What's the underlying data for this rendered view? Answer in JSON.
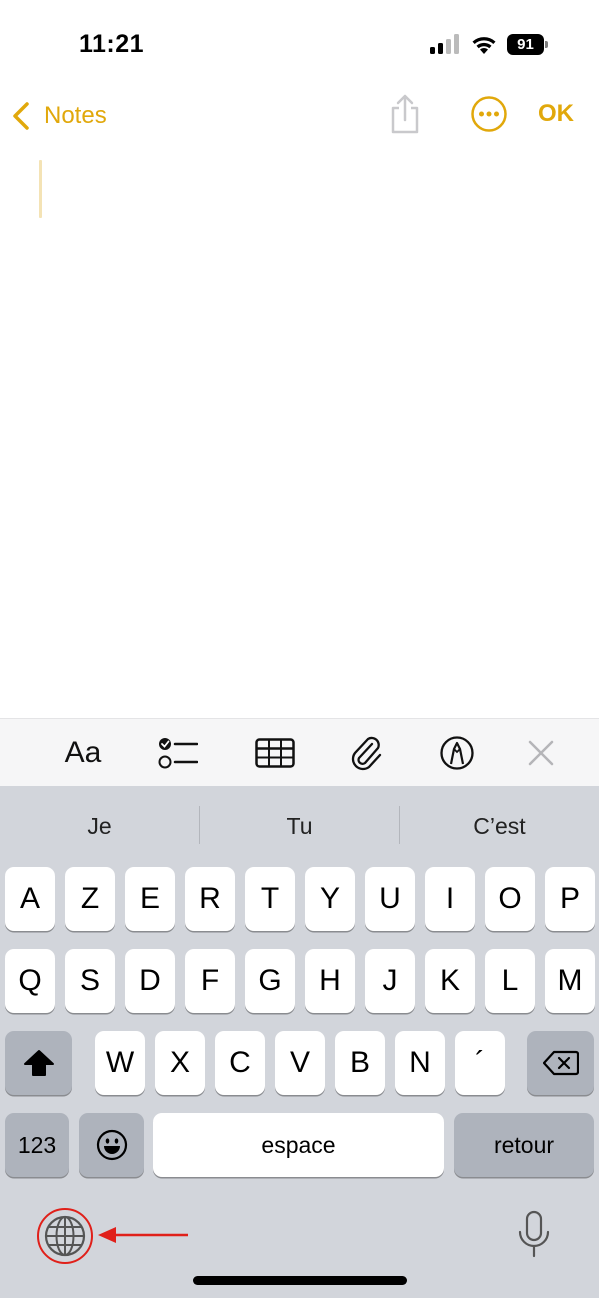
{
  "status_bar": {
    "time": "11:21",
    "battery": "91",
    "icons": [
      "cellular-signal-icon",
      "wifi-icon",
      "battery-icon"
    ]
  },
  "nav": {
    "back_label": "Notes",
    "done_label": "OK",
    "icons": [
      "chevron-left-icon",
      "share-icon",
      "more-icon"
    ],
    "accent_color": "#e1a80b"
  },
  "toolbar": {
    "format_label": "Aa",
    "icons": [
      "checklist-icon",
      "table-icon",
      "paperclip-icon",
      "markup-pen-icon",
      "close-icon"
    ]
  },
  "keyboard": {
    "suggestions": [
      "Je",
      "Tu",
      "C’est"
    ],
    "rows": [
      [
        "A",
        "Z",
        "E",
        "R",
        "T",
        "Y",
        "U",
        "I",
        "O",
        "P"
      ],
      [
        "Q",
        "S",
        "D",
        "F",
        "G",
        "H",
        "J",
        "K",
        "L",
        "M"
      ],
      [
        "W",
        "X",
        "C",
        "V",
        "B",
        "N",
        "´"
      ]
    ],
    "numbers_label": "123",
    "space_label": "espace",
    "return_label": "retour",
    "icons": [
      "shift-icon",
      "backspace-icon",
      "emoji-icon",
      "globe-icon",
      "microphone-icon"
    ],
    "background_color": "#d2d5db"
  },
  "annotation": {
    "color": "#e0201a",
    "highlight": "globe-button"
  }
}
